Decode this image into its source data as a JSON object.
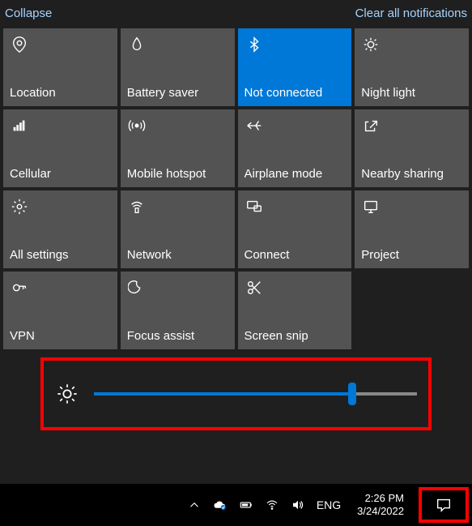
{
  "header": {
    "collapse": "Collapse",
    "clear": "Clear all notifications"
  },
  "tiles": [
    {
      "id": "location",
      "label": "Location",
      "icon": "location-icon",
      "active": false
    },
    {
      "id": "battery-saver",
      "label": "Battery saver",
      "icon": "battery-saver-icon",
      "active": false
    },
    {
      "id": "bluetooth",
      "label": "Not connected",
      "icon": "bluetooth-icon",
      "active": true
    },
    {
      "id": "night-light",
      "label": "Night light",
      "icon": "night-light-icon",
      "active": false
    },
    {
      "id": "cellular",
      "label": "Cellular",
      "icon": "cellular-icon",
      "active": false
    },
    {
      "id": "mobile-hotspot",
      "label": "Mobile hotspot",
      "icon": "hotspot-icon",
      "active": false
    },
    {
      "id": "airplane-mode",
      "label": "Airplane mode",
      "icon": "airplane-icon",
      "active": false
    },
    {
      "id": "nearby-sharing",
      "label": "Nearby sharing",
      "icon": "share-icon",
      "active": false
    },
    {
      "id": "all-settings",
      "label": "All settings",
      "icon": "settings-icon",
      "active": false
    },
    {
      "id": "network",
      "label": "Network",
      "icon": "network-icon",
      "active": false
    },
    {
      "id": "connect",
      "label": "Connect",
      "icon": "connect-icon",
      "active": false
    },
    {
      "id": "project",
      "label": "Project",
      "icon": "project-icon",
      "active": false
    },
    {
      "id": "vpn",
      "label": "VPN",
      "icon": "vpn-icon",
      "active": false
    },
    {
      "id": "focus-assist",
      "label": "Focus assist",
      "icon": "focus-assist-icon",
      "active": false
    },
    {
      "id": "screen-snip",
      "label": "Screen snip",
      "icon": "screen-snip-icon",
      "active": false
    }
  ],
  "brightness": {
    "percent": 80
  },
  "taskbar": {
    "language": "ENG",
    "time": "2:26 PM",
    "date": "3/24/2022"
  },
  "colors": {
    "accent": "#0078d7",
    "highlight": "#ff0000"
  }
}
